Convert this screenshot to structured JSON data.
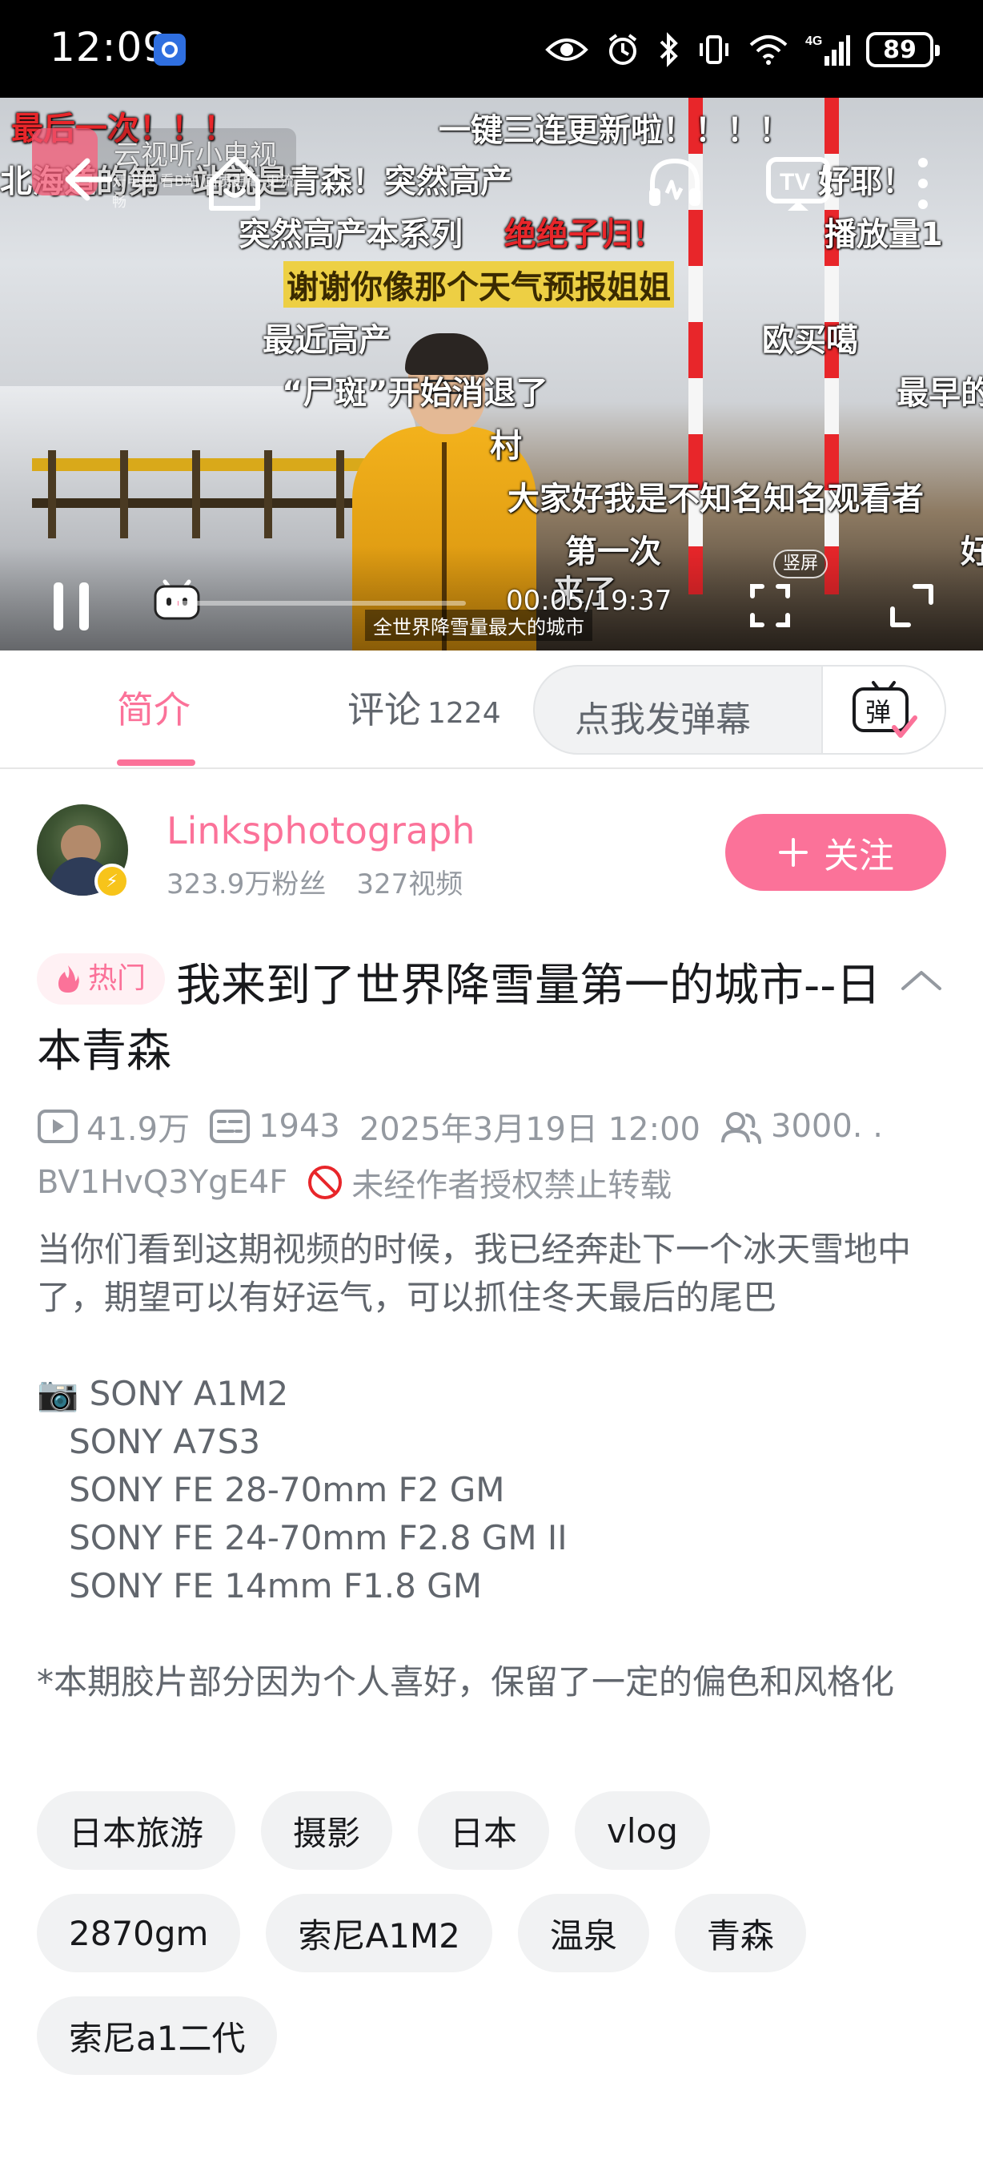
{
  "status_bar": {
    "time": "12:09",
    "network": "4G",
    "battery": "89"
  },
  "video": {
    "watermark_title": "云视听小电视",
    "watermark_sub": "开电视 看B站 画质更高 更流畅",
    "current_time": "00:05/19:37",
    "vertical_screen_label": "竖屏",
    "subtitle": "全世界降雪量最大的城市",
    "progress_fraction": 0.004,
    "danmaku": [
      "最后一次！！！",
      "一键三连更新啦！！！！",
      "北海道的第一站就是青森！突然高产",
      "好耶！",
      "突然高产本系列",
      "绝绝子归！",
      "播放量1",
      "谢谢你像那个天气预报姐姐",
      "最近高产",
      "欧买噶",
      "“尸斑”开始消退了",
      "最早的",
      "村",
      "大家好我是不知名知名观看者",
      "第一次",
      "来了",
      "好"
    ]
  },
  "tabs": {
    "intro_label": "简介",
    "comments_label": "评论",
    "comments_count": "1224",
    "danmaku_placeholder": "点我发弹幕",
    "danmaku_button_label": "弹"
  },
  "uploader": {
    "name": "Linksphotograph",
    "followers": "323.9万粉丝",
    "videos": "327视频",
    "follow_label": "关注"
  },
  "video_info": {
    "hot_badge": "热门",
    "title": "我来到了世界降雪量第一的城市--日本青森",
    "views": "41.9万",
    "danmaku_count": "1943",
    "publish_time": "2025年3月19日 12:00",
    "watching": "3000. .",
    "bvid": "BV1HvQ3YgE4F",
    "repost_notice": "未经作者授权禁止转载",
    "description": "当你们看到这期视频的时候，我已经奔赴下一个冰天雪地中了，期望可以有好运气，可以抓住冬天最后的尾巴\n\n📷 SONY A1M2\n   SONY A7S3\n   SONY FE 28-70mm F2 GM\n   SONY FE 24-70mm F2.8 GM II\n   SONY FE 14mm F1.8 GM\n\n*本期胶片部分因为个人喜好，保留了一定的偏色和风格化"
  },
  "tags": [
    [
      "日本旅游",
      "摄影",
      "日本",
      "vlog"
    ],
    [
      "2870gm",
      "索尼A1M2",
      "温泉",
      "青森"
    ],
    [
      "索尼a1二代"
    ]
  ],
  "colors": {
    "brand_pink": "#fb7299",
    "text_primary": "#18191c",
    "text_secondary": "#61666d",
    "text_tertiary": "#9499a0",
    "tag_bg": "#f1f2f3"
  }
}
